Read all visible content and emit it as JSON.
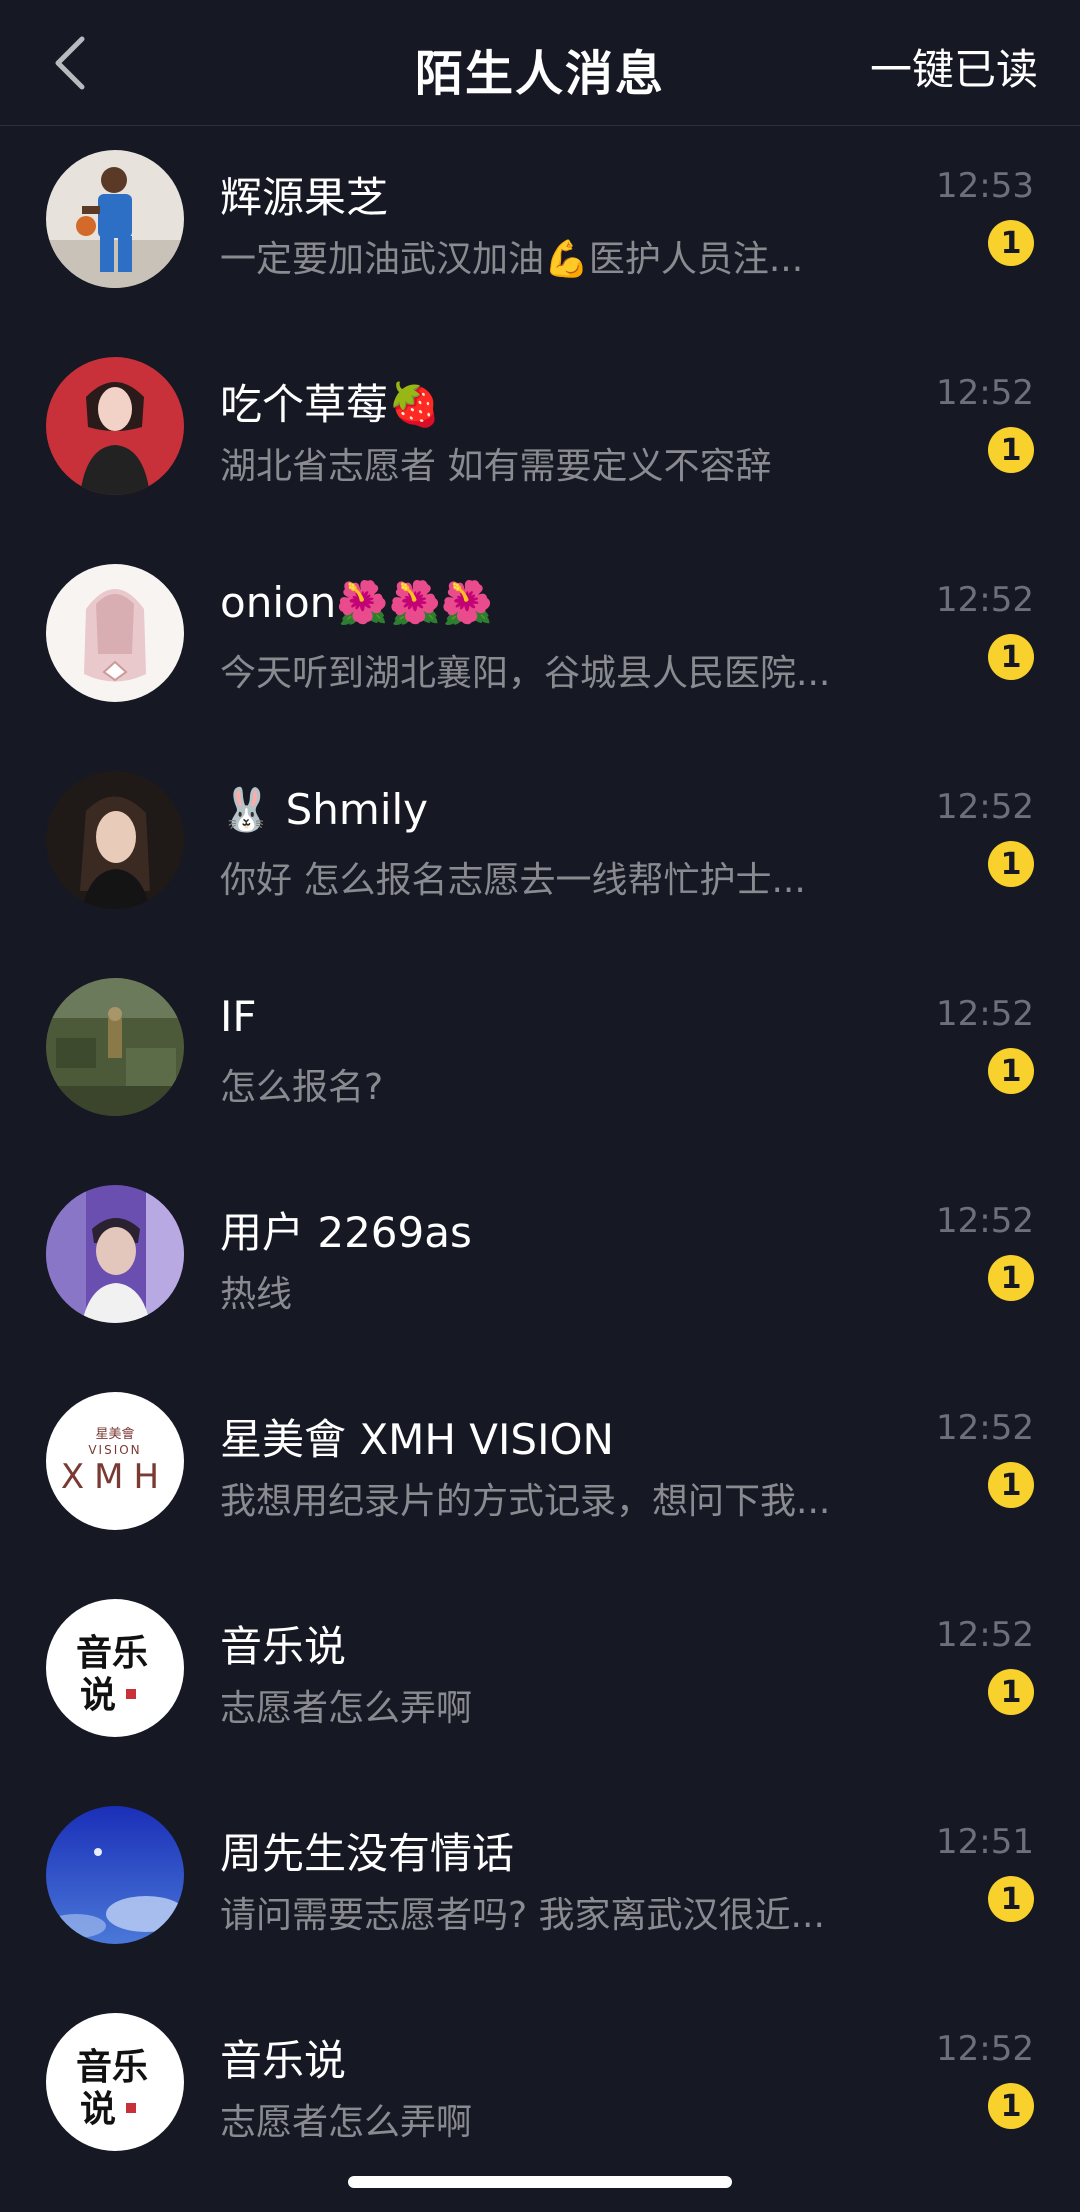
{
  "header": {
    "title": "陌生人消息",
    "read_all": "一键已读"
  },
  "messages": [
    {
      "name": "辉源果芝",
      "preview": "一定要加油武汉加油💪医护人员注...",
      "time": "12:53",
      "badge": "1"
    },
    {
      "name": "吃个草莓🍓",
      "preview": "湖北省志愿者 如有需要定义不容辞",
      "time": "12:52",
      "badge": "1"
    },
    {
      "name": "onion🌺🌺🌺",
      "preview": "今天听到湖北襄阳，谷城县人民医院...",
      "time": "12:52",
      "badge": "1"
    },
    {
      "name": "🐰 Shmily",
      "preview": "你好 怎么报名志愿去一线帮忙护士...",
      "time": "12:52",
      "badge": "1"
    },
    {
      "name": "IF",
      "preview": "怎么报名?",
      "time": "12:52",
      "badge": "1"
    },
    {
      "name": "用户 2269as",
      "preview": "热线",
      "time": "12:52",
      "badge": "1"
    },
    {
      "name": "星美會 XMH VISION",
      "preview": "我想用纪录片的方式记录，想问下我...",
      "time": "12:52",
      "badge": "1"
    },
    {
      "name": "音乐说",
      "preview": "志愿者怎么弄啊",
      "time": "12:52",
      "badge": "1"
    },
    {
      "name": "周先生没有情话",
      "preview": "请问需要志愿者吗? 我家离武汉很近...",
      "time": "12:51",
      "badge": "1"
    },
    {
      "name": "音乐说",
      "preview": "志愿者怎么弄啊",
      "time": "12:52",
      "badge": "1"
    }
  ],
  "avatars": {
    "xmh_top": "星美會",
    "xmh_mid": "VISION",
    "xmh_bottom": "XMH",
    "music_line1": "音乐",
    "music_line2": "说"
  },
  "colors": {
    "background": "#161823",
    "badge": "#f8d12d",
    "secondary_text": "#8a8b91",
    "time_text": "#6e7079"
  }
}
